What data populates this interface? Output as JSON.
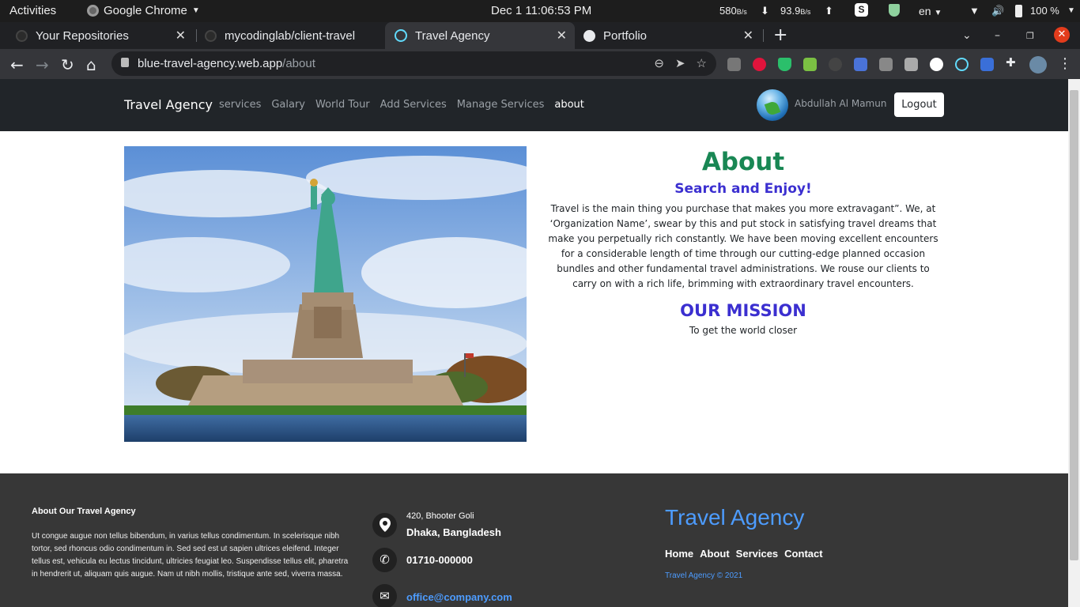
{
  "os_bar": {
    "activities": "Activities",
    "app_name": "Google Chrome",
    "clock": "Dec 1  11:06:53 PM",
    "net_down": "580",
    "net_down_unit": "B/s",
    "net_up": "93.9",
    "net_up_unit": "B/s",
    "lang": "en",
    "battery": "100 %"
  },
  "tabs": [
    {
      "title": "Your Repositories"
    },
    {
      "title": "mycodinglab/client-travel"
    },
    {
      "title": "Travel Agency"
    },
    {
      "title": "Portfolio"
    }
  ],
  "address": {
    "host": "blue-travel-agency.web.app",
    "path": "/about"
  },
  "site_nav": {
    "brand": "Travel Agency",
    "links": [
      "services",
      "Galary",
      "World Tour",
      "Add Services",
      "Manage Services",
      "about"
    ],
    "user_name": "Abdullah Al Mamun",
    "logout": "Logout"
  },
  "about": {
    "title": "About",
    "subtitle": "Search and Enjoy!",
    "body": "Travel is the main thing you purchase that makes you more extravagant”. We, at ‘Organization Name’, swear by this and put stock in satisfying travel dreams that make you perpetually rich constantly. We have been moving excellent encounters for a considerable length of time through our cutting-edge planned occasion bundles and other fundamental travel administrations. We rouse our clients to carry on with a rich life, brimming with extraordinary travel encounters.",
    "mission_title": "OUR MISSION",
    "mission_text": "To get the world closer"
  },
  "footer": {
    "about_title": "About Our Travel Agency",
    "about_text": "Ut congue augue non tellus bibendum, in varius tellus condimentum. In scelerisque nibh tortor, sed rhoncus odio condimentum in. Sed sed est ut sapien ultrices eleifend. Integer tellus est, vehicula eu lectus tincidunt, ultricies feugiat leo. Suspendisse tellus elit, pharetra in hendrerit ut, aliquam quis augue. Nam ut nibh mollis, tristique ante sed, viverra massa.",
    "address_line1": "420, Bhooter Goli",
    "address_line2": "Dhaka, Bangladesh",
    "phone": "01710-000000",
    "email": "office@company.com",
    "brand": "Travel Agency",
    "links": [
      "Home",
      "About",
      "Services",
      "Contact"
    ],
    "copyright": "Travel Agency © 2021"
  }
}
